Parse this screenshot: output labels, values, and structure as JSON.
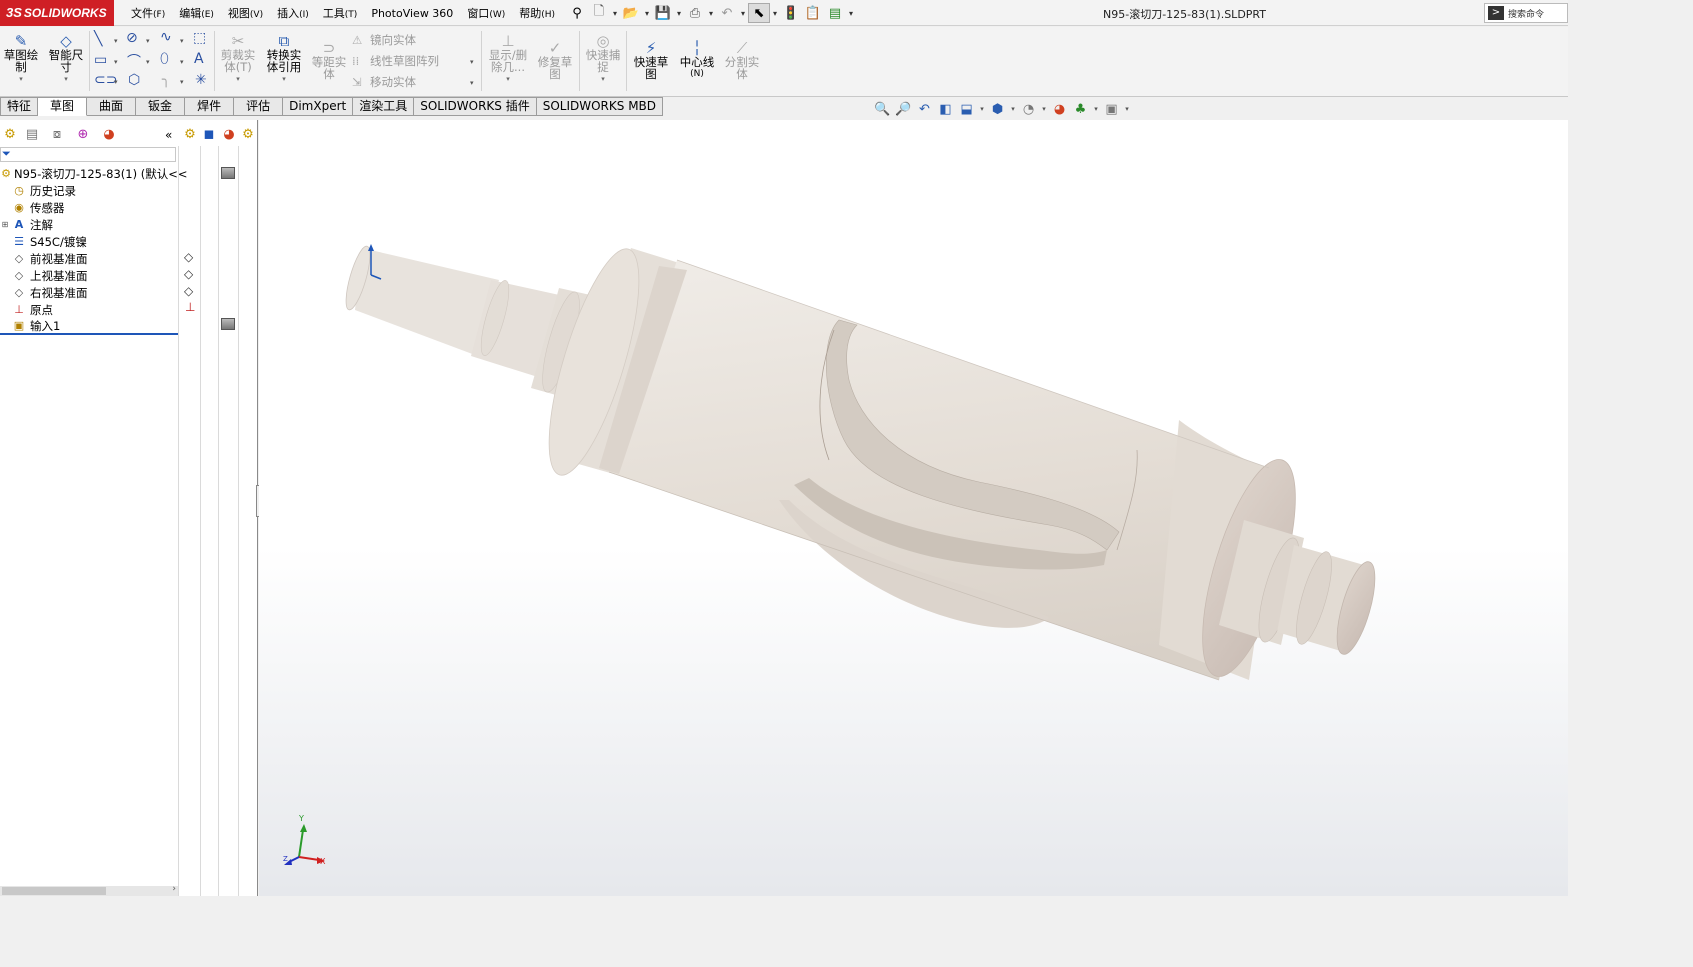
{
  "app": {
    "name": "SOLIDWORKS",
    "document_title": "N95-滚切刀-125-83(1).SLDPRT"
  },
  "menu": [
    {
      "label": "文件",
      "key": "(F)"
    },
    {
      "label": "编辑",
      "key": "(E)"
    },
    {
      "label": "视图",
      "key": "(V)"
    },
    {
      "label": "插入",
      "key": "(I)"
    },
    {
      "label": "工具",
      "key": "(T)"
    },
    {
      "label": "PhotoView 360",
      "key": ""
    },
    {
      "label": "窗口",
      "key": "(W)"
    },
    {
      "label": "帮助",
      "key": "(H)"
    }
  ],
  "search": {
    "label": "搜索命令"
  },
  "ribbon": {
    "sketch": {
      "line1": "草图绘",
      "line2": "制"
    },
    "smart_dim": {
      "line1": "智能尺",
      "line2": "寸"
    },
    "trim": {
      "line1": "剪裁实",
      "line2": "体(T)"
    },
    "convert": {
      "line1": "转换实",
      "line2": "体引用"
    },
    "offset": {
      "line1": "等距实",
      "line2": "体"
    },
    "mirror": "镜向实体",
    "linear_pattern": "线性草图阵列",
    "move": "移动实体",
    "display_delete": {
      "line1": "显示/删",
      "line2": "除几..."
    },
    "repair": {
      "line1": "修复草",
      "line2": "图"
    },
    "quick_snaps": {
      "line1": "快速捕",
      "line2": "捉"
    },
    "rapid_sketch": {
      "line1": "快速草",
      "line2": "图"
    },
    "centerline": {
      "line1": "中心线",
      "line2": "(N)"
    },
    "split": {
      "line1": "分割实",
      "line2": "体"
    }
  },
  "tabs": [
    "特征",
    "草图",
    "曲面",
    "钣金",
    "焊件",
    "评估",
    "DimXpert",
    "渲染工具",
    "SOLIDWORKS 插件",
    "SOLIDWORKS MBD"
  ],
  "active_tab": "草图",
  "feature_tree": {
    "root": "N95-滚切刀-125-83(1)  (默认<<",
    "items": [
      {
        "label": "历史记录"
      },
      {
        "label": "传感器"
      },
      {
        "label": "注解"
      },
      {
        "label": "S45C/镀镍"
      },
      {
        "label": "前视基准面"
      },
      {
        "label": "上视基准面"
      },
      {
        "label": "右视基准面"
      },
      {
        "label": "原点"
      },
      {
        "label": "输入1"
      }
    ]
  },
  "triad": {
    "x": "X",
    "y": "Y",
    "z": "Z"
  },
  "colors": {
    "brand_red": "#cf1f25",
    "model": "#e3ddd6",
    "accent_blue": "#1e56b8"
  }
}
